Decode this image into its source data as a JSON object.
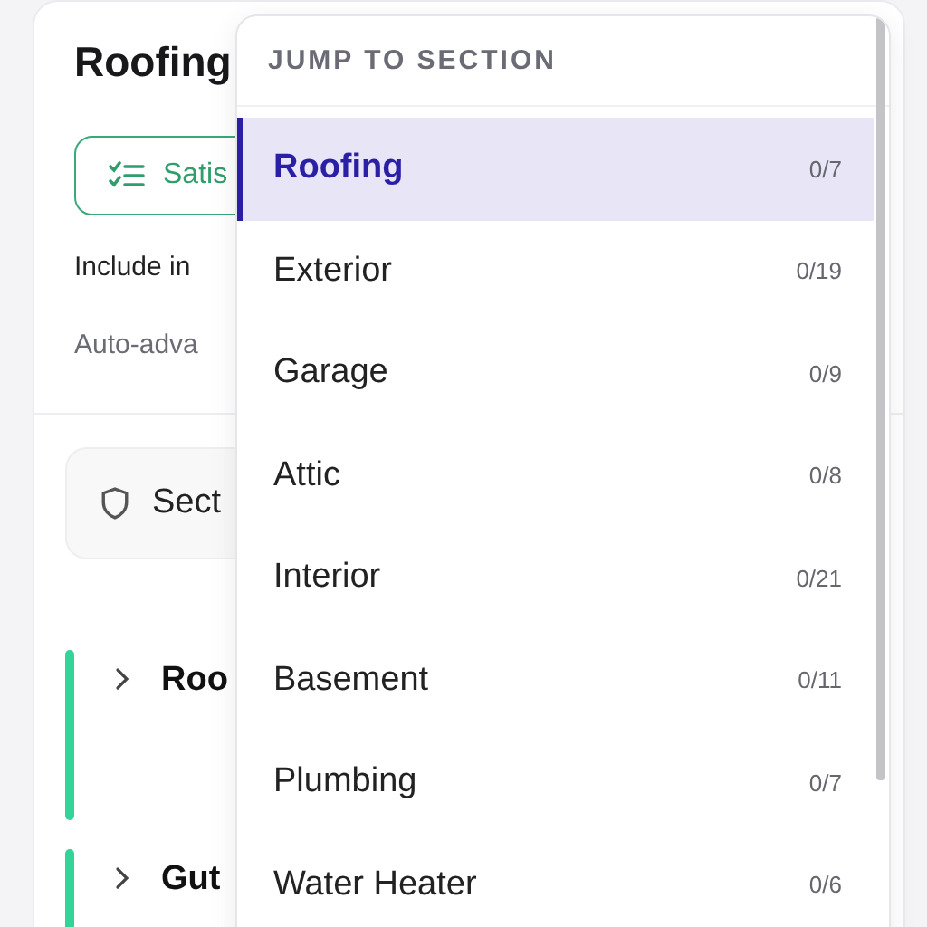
{
  "page": {
    "title": "Roofing",
    "filter_button": "Satis",
    "include_label": "Include in",
    "auto_label": "Auto-adva",
    "section_card": "Sect",
    "groups": [
      {
        "title": "Roo",
        "expanded": false,
        "color": "#34d399"
      },
      {
        "title": "Gut",
        "expanded": false,
        "color": "#34d399"
      }
    ]
  },
  "menu": {
    "heading": "JUMP TO SECTION",
    "items": [
      {
        "label": "Roofing",
        "count": "0/7",
        "selected": true
      },
      {
        "label": "Exterior",
        "count": "0/19",
        "selected": false
      },
      {
        "label": "Garage",
        "count": "0/9",
        "selected": false
      },
      {
        "label": "Attic",
        "count": "0/8",
        "selected": false
      },
      {
        "label": "Interior",
        "count": "0/21",
        "selected": false
      },
      {
        "label": "Basement",
        "count": "0/11",
        "selected": false
      },
      {
        "label": "Plumbing",
        "count": "0/7",
        "selected": false
      },
      {
        "label": "Water Heater",
        "count": "0/6",
        "selected": false
      }
    ]
  }
}
